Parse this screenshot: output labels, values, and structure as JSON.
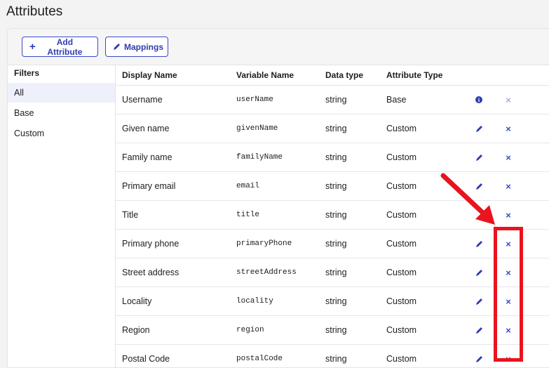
{
  "page": {
    "title": "Attributes"
  },
  "toolbar": {
    "add_label": "Add Attribute",
    "mappings_label": "Mappings"
  },
  "sidebar": {
    "heading": "Filters",
    "items": [
      {
        "label": "All",
        "active": true
      },
      {
        "label": "Base",
        "active": false
      },
      {
        "label": "Custom",
        "active": false
      }
    ]
  },
  "table": {
    "columns": [
      "Display Name",
      "Variable Name",
      "Data type",
      "Attribute Type"
    ],
    "rows": [
      {
        "display": "Username",
        "variable": "userName",
        "type": "string",
        "attr_type": "Base",
        "action": "info-icon",
        "delete_enabled": false
      },
      {
        "display": "Given name",
        "variable": "givenName",
        "type": "string",
        "attr_type": "Custom",
        "action": "edit-icon",
        "delete_enabled": true
      },
      {
        "display": "Family name",
        "variable": "familyName",
        "type": "string",
        "attr_type": "Custom",
        "action": "edit-icon",
        "delete_enabled": true
      },
      {
        "display": "Primary email",
        "variable": "email",
        "type": "string",
        "attr_type": "Custom",
        "action": "edit-icon",
        "delete_enabled": true
      },
      {
        "display": "Title",
        "variable": "title",
        "type": "string",
        "attr_type": "Custom",
        "action": "none",
        "delete_enabled": true
      },
      {
        "display": "Primary phone",
        "variable": "primaryPhone",
        "type": "string",
        "attr_type": "Custom",
        "action": "edit-icon",
        "delete_enabled": true
      },
      {
        "display": "Street address",
        "variable": "streetAddress",
        "type": "string",
        "attr_type": "Custom",
        "action": "edit-icon",
        "delete_enabled": true
      },
      {
        "display": "Locality",
        "variable": "locality",
        "type": "string",
        "attr_type": "Custom",
        "action": "edit-icon",
        "delete_enabled": true
      },
      {
        "display": "Region",
        "variable": "region",
        "type": "string",
        "attr_type": "Custom",
        "action": "edit-icon",
        "delete_enabled": true
      },
      {
        "display": "Postal Code",
        "variable": "postalCode",
        "type": "string",
        "attr_type": "Custom",
        "action": "edit-icon",
        "delete_enabled": true
      }
    ]
  },
  "colors": {
    "accent": "#3a49c7",
    "annotation": "#e8141e"
  }
}
